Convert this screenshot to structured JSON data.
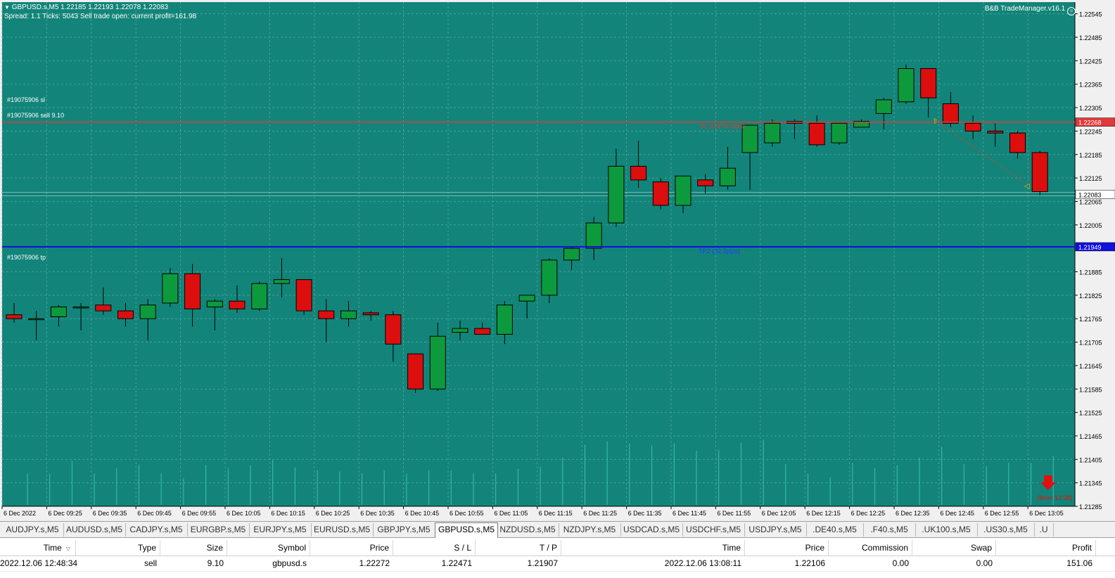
{
  "chart": {
    "symbol_line": "GBPUSD.s,M5  1.22185 1.22193 1.22078 1.22083",
    "status_line": "Spread: 1.1   Ticks: 5043   Sell trade open: current profit=161.98",
    "ea_badge": "B&B TradeManager.v16.1",
    "colors": {
      "background": "#138479",
      "grid": "#4da89f",
      "bull": "#0d9a3c",
      "bear": "#dd0e0e",
      "sl_line": "#e23a3a",
      "tp_line": "#1010e0",
      "volume": "#3dbfb2"
    },
    "trade_labels": {
      "sl": "#19075906 sl",
      "entry": "#19075906 sell 9.10",
      "tp": "#19075906 tp"
    },
    "line_texts": {
      "sl": "SL (0.97% pips)",
      "tp": "TP2 (32.3pips)"
    },
    "price_markers": {
      "sl": "1.22268",
      "current": "1.22083",
      "tp": "1.21949"
    },
    "timer_text": "(8min 12:38)",
    "timer_icon": "down-arrow-icon",
    "price_axis": [
      "1.22545",
      "1.22485",
      "1.22425",
      "1.22365",
      "1.22305",
      "1.22245",
      "1.22185",
      "1.22125",
      "1.22065",
      "1.22005",
      "1.21885",
      "1.21825",
      "1.21765",
      "1.21705",
      "1.21645",
      "1.21585",
      "1.21525",
      "1.21465",
      "1.21405",
      "1.21345",
      "1.21285"
    ],
    "time_axis": [
      "6 Dec 2022",
      "6 Dec 09:25",
      "6 Dec 09:35",
      "6 Dec 09:45",
      "6 Dec 09:55",
      "6 Dec 10:05",
      "6 Dec 10:15",
      "6 Dec 10:25",
      "6 Dec 10:35",
      "6 Dec 10:45",
      "6 Dec 10:55",
      "6 Dec 11:05",
      "6 Dec 11:15",
      "6 Dec 11:25",
      "6 Dec 11:35",
      "6 Dec 11:45",
      "6 Dec 11:55",
      "6 Dec 12:05",
      "6 Dec 12:15",
      "6 Dec 12:25",
      "6 Dec 12:35",
      "6 Dec 12:45",
      "6 Dec 12:55",
      "6 Dec 13:05"
    ]
  },
  "chart_data": {
    "type": "candlestick",
    "series": [
      {
        "o": 1.21775,
        "h": 1.21805,
        "l": 1.21755,
        "c": 1.21765
      },
      {
        "o": 1.21765,
        "h": 1.21785,
        "l": 1.2171,
        "c": 1.21765
      },
      {
        "o": 1.2177,
        "h": 1.218,
        "l": 1.21745,
        "c": 1.21795
      },
      {
        "o": 1.21795,
        "h": 1.21805,
        "l": 1.21735,
        "c": 1.21795
      },
      {
        "o": 1.218,
        "h": 1.21845,
        "l": 1.21775,
        "c": 1.21785
      },
      {
        "o": 1.21785,
        "h": 1.21805,
        "l": 1.21745,
        "c": 1.21765
      },
      {
        "o": 1.21765,
        "h": 1.21815,
        "l": 1.2171,
        "c": 1.218
      },
      {
        "o": 1.21805,
        "h": 1.21895,
        "l": 1.21795,
        "c": 1.2188
      },
      {
        "o": 1.2188,
        "h": 1.21905,
        "l": 1.21745,
        "c": 1.2179
      },
      {
        "o": 1.21795,
        "h": 1.21815,
        "l": 1.21735,
        "c": 1.2181
      },
      {
        "o": 1.2181,
        "h": 1.2185,
        "l": 1.2178,
        "c": 1.2179
      },
      {
        "o": 1.2179,
        "h": 1.2186,
        "l": 1.21785,
        "c": 1.21855
      },
      {
        "o": 1.21855,
        "h": 1.2192,
        "l": 1.2182,
        "c": 1.21865
      },
      {
        "o": 1.21865,
        "h": 1.21865,
        "l": 1.21775,
        "c": 1.21785
      },
      {
        "o": 1.21785,
        "h": 1.21815,
        "l": 1.21705,
        "c": 1.21765
      },
      {
        "o": 1.21765,
        "h": 1.2181,
        "l": 1.21745,
        "c": 1.21785
      },
      {
        "o": 1.2178,
        "h": 1.21785,
        "l": 1.2176,
        "c": 1.21775
      },
      {
        "o": 1.21775,
        "h": 1.21785,
        "l": 1.21655,
        "c": 1.217
      },
      {
        "o": 1.21675,
        "h": 1.21675,
        "l": 1.21575,
        "c": 1.21585
      },
      {
        "o": 1.21585,
        "h": 1.21755,
        "l": 1.2158,
        "c": 1.2172
      },
      {
        "o": 1.2173,
        "h": 1.2176,
        "l": 1.2171,
        "c": 1.2174
      },
      {
        "o": 1.2174,
        "h": 1.21755,
        "l": 1.21725,
        "c": 1.21725
      },
      {
        "o": 1.21725,
        "h": 1.2181,
        "l": 1.217,
        "c": 1.218
      },
      {
        "o": 1.2181,
        "h": 1.21825,
        "l": 1.21765,
        "c": 1.21825
      },
      {
        "o": 1.21825,
        "h": 1.2192,
        "l": 1.21805,
        "c": 1.21915
      },
      {
        "o": 1.21915,
        "h": 1.2195,
        "l": 1.2189,
        "c": 1.21945
      },
      {
        "o": 1.21945,
        "h": 1.22025,
        "l": 1.21915,
        "c": 1.2201
      },
      {
        "o": 1.2201,
        "h": 1.222,
        "l": 1.22,
        "c": 1.22155
      },
      {
        "o": 1.22155,
        "h": 1.2222,
        "l": 1.221,
        "c": 1.2212
      },
      {
        "o": 1.22115,
        "h": 1.22125,
        "l": 1.22045,
        "c": 1.22055
      },
      {
        "o": 1.22055,
        "h": 1.2213,
        "l": 1.22035,
        "c": 1.2213
      },
      {
        "o": 1.2212,
        "h": 1.22135,
        "l": 1.22085,
        "c": 1.22105
      },
      {
        "o": 1.22105,
        "h": 1.22205,
        "l": 1.22095,
        "c": 1.2215
      },
      {
        "o": 1.2219,
        "h": 1.2226,
        "l": 1.22095,
        "c": 1.2226
      },
      {
        "o": 1.22215,
        "h": 1.22275,
        "l": 1.22205,
        "c": 1.22265
      },
      {
        "o": 1.2227,
        "h": 1.22275,
        "l": 1.22225,
        "c": 1.22265
      },
      {
        "o": 1.22265,
        "h": 1.22285,
        "l": 1.22205,
        "c": 1.2221
      },
      {
        "o": 1.22215,
        "h": 1.22265,
        "l": 1.2221,
        "c": 1.22265
      },
      {
        "o": 1.22255,
        "h": 1.22275,
        "l": 1.22255,
        "c": 1.2227
      },
      {
        "o": 1.2229,
        "h": 1.2233,
        "l": 1.2225,
        "c": 1.22325
      },
      {
        "o": 1.2232,
        "h": 1.22415,
        "l": 1.22315,
        "c": 1.22405
      },
      {
        "o": 1.22405,
        "h": 1.22405,
        "l": 1.2228,
        "c": 1.2233
      },
      {
        "o": 1.22315,
        "h": 1.22345,
        "l": 1.22255,
        "c": 1.22265
      },
      {
        "o": 1.22265,
        "h": 1.22285,
        "l": 1.22225,
        "c": 1.22245
      },
      {
        "o": 1.22245,
        "h": 1.22265,
        "l": 1.22205,
        "c": 1.2224
      },
      {
        "o": 1.2224,
        "h": 1.22245,
        "l": 1.22175,
        "c": 1.2219
      },
      {
        "o": 1.2219,
        "h": 1.22195,
        "l": 1.2208,
        "c": 1.2209
      }
    ],
    "volumes": [
      0.47,
      0.47,
      0.66,
      0.47,
      0.55,
      0.6,
      0.47,
      0.4,
      0.6,
      0.55,
      0.59,
      0.67,
      0.56,
      0.52,
      0.5,
      0.47,
      0.52,
      0.47,
      0.52,
      0.52,
      0.47,
      0.47,
      0.54,
      0.57,
      0.71,
      0.9,
      0.95,
      0.92,
      0.89,
      0.92,
      0.81,
      0.83,
      0.93,
      0.97,
      0.61,
      0.47,
      0.41,
      0.63,
      0.55,
      0.59,
      0.71,
      0.87,
      0.61,
      0.58,
      0.63,
      0.63,
      0.73
    ],
    "ylim": [
      1.21285,
      1.22575
    ],
    "sl": 1.22268,
    "tp": 1.21949,
    "current": 1.22083,
    "grid": true
  },
  "tabs": [
    "AUDJPY.s,M5",
    "AUDUSD.s,M5",
    "CADJPY.s,M5",
    "EURGBP.s,M5",
    "EURJPY.s,M5",
    "EURUSD.s,M5",
    "GBPJPY.s,M5",
    "GBPUSD.s,M5",
    "NZDUSD.s,M5",
    "NZDJPY.s,M5",
    "USDCAD.s,M5",
    "USDCHF.s,M5",
    "USDJPY.s,M5",
    ".DE40.s,M5",
    ".F40.s,M5",
    ".UK100.s,M5",
    ".US30.s,M5",
    ".U"
  ],
  "active_tab": "GBPUSD.s,M5",
  "table": {
    "headers": [
      "Time",
      "Type",
      "Size",
      "Symbol",
      "Price",
      "S / L",
      "T / P",
      "Time",
      "Price",
      "Commission",
      "Swap",
      "Profit"
    ],
    "sort_icon": "sort-desc-icon",
    "row": [
      "2022.12.06 12:48:34",
      "sell",
      "9.10",
      "gbpusd.s",
      "1.22272",
      "1.22471",
      "1.21907",
      "2022.12.06 13:08:11",
      "1.22106",
      "0.00",
      "0.00",
      "151.06"
    ]
  }
}
